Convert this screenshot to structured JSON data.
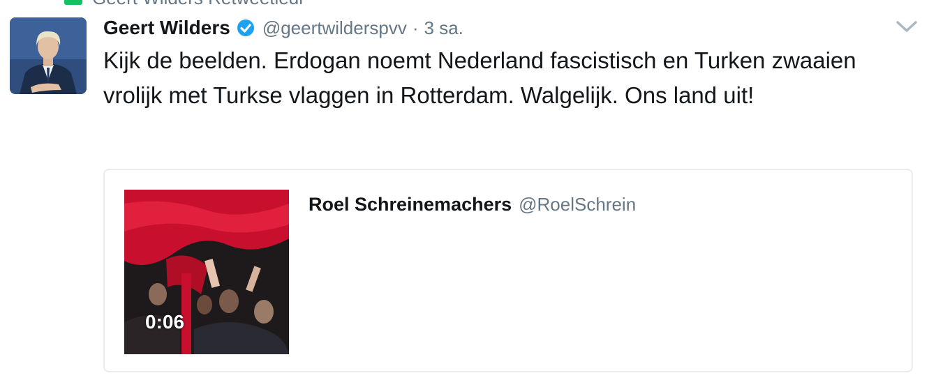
{
  "context": {
    "text": "Geert Wilders Retweetledi"
  },
  "tweet": {
    "author_name": "Geert Wilders",
    "handle": "@geertwilderspvv",
    "separator": "·",
    "time": "3 sa.",
    "text": "Kijk de beelden. Erdogan noemt Nederland fascistisch en Turken zwaaien vrolijk met Turkse vlaggen in Rotterdam. Walgelijk. Ons land uit!"
  },
  "quote": {
    "author_name": "Roel Schreinemachers",
    "handle": "@RoelSchrein",
    "video_duration": "0:06"
  },
  "colors": {
    "verified": "#1da1f2",
    "secondary_text": "#657786",
    "border": "#e6ecf0",
    "retweet_icon": "#17bf63"
  }
}
